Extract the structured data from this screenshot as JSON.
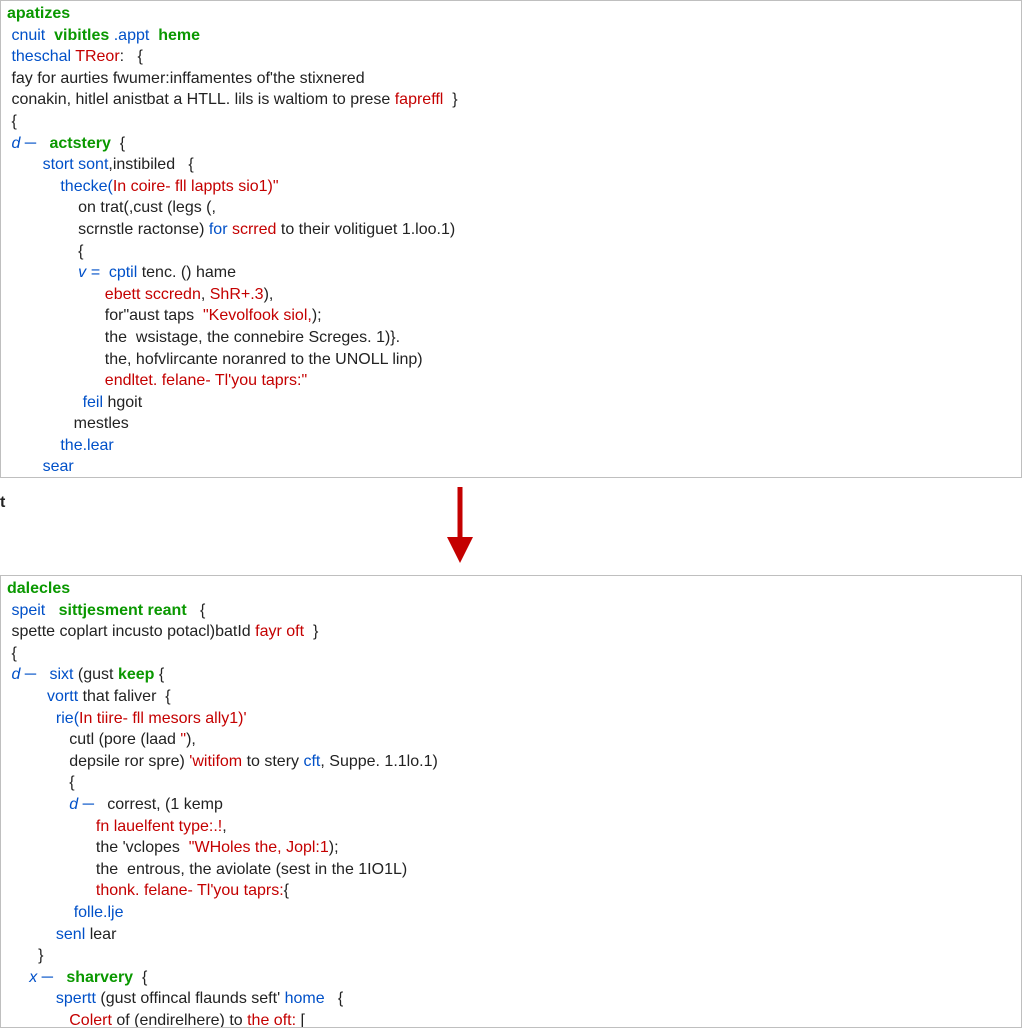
{
  "arrow_label": "transforms-to",
  "floating_glyph": "t",
  "top_panel": {
    "lines": [
      [
        {
          "cls": "kw",
          "t": "apatizes"
        }
      ],
      [
        {
          "cls": "plain",
          "t": " "
        },
        {
          "cls": "id",
          "t": "cnuit"
        },
        {
          "cls": "plain",
          "t": "  "
        },
        {
          "cls": "kw",
          "t": "vibitles"
        },
        {
          "cls": "plain",
          "t": " "
        },
        {
          "cls": "id",
          "t": ".appt"
        },
        {
          "cls": "plain",
          "t": "  "
        },
        {
          "cls": "kw",
          "t": "heme"
        }
      ],
      [
        {
          "cls": "plain",
          "t": " "
        },
        {
          "cls": "id",
          "t": "theschal"
        },
        {
          "cls": "plain",
          "t": " "
        },
        {
          "cls": "err",
          "t": "TReor"
        },
        {
          "cls": "plain",
          "t": ":   {"
        }
      ],
      [
        {
          "cls": "plain",
          "t": " fay for aurties fwumer:inffamentes of'the stixnered"
        }
      ],
      [
        {
          "cls": "plain",
          "t": " conakin, hitlel anistbat a HTLL. lils is waltiom to prese "
        },
        {
          "cls": "err",
          "t": "fapreffl"
        },
        {
          "cls": "plain",
          "t": "  }"
        }
      ],
      [
        {
          "cls": "plain",
          "t": " {"
        }
      ],
      [
        {
          "cls": "d-marker",
          "t": " d ─"
        },
        {
          "cls": "plain",
          "t": "   "
        },
        {
          "cls": "kw",
          "t": "actstery"
        },
        {
          "cls": "plain",
          "t": "  {"
        }
      ],
      [
        {
          "cls": "plain",
          "t": "        "
        },
        {
          "cls": "id",
          "t": "stort"
        },
        {
          "cls": "plain",
          "t": " "
        },
        {
          "cls": "id",
          "t": "sont"
        },
        {
          "cls": "plain",
          "t": ",instibiled   {"
        }
      ],
      [
        {
          "cls": "plain",
          "t": "            "
        },
        {
          "cls": "id",
          "t": "thecke("
        },
        {
          "cls": "err",
          "t": "In coire- fll lappts sio1"
        },
        {
          "cls": "str",
          "t": ")\""
        }
      ],
      [
        {
          "cls": "plain",
          "t": "                on trat(,cust (legs (,"
        }
      ],
      [
        {
          "cls": "plain",
          "t": "                scrnstle ractonse) "
        },
        {
          "cls": "id",
          "t": "for"
        },
        {
          "cls": "plain",
          "t": " "
        },
        {
          "cls": "err",
          "t": "scrred"
        },
        {
          "cls": "plain",
          "t": " to their volitiguet 1.loo.1)"
        }
      ],
      [
        {
          "cls": "plain",
          "t": "                {"
        }
      ],
      [
        {
          "cls": "plain",
          "t": "                "
        },
        {
          "cls": "dimblue",
          "t": "v ="
        },
        {
          "cls": "plain",
          "t": "  "
        },
        {
          "cls": "id",
          "t": "cptil"
        },
        {
          "cls": "plain",
          "t": " tenc. () hame"
        }
      ],
      [
        {
          "cls": "plain",
          "t": "                      "
        },
        {
          "cls": "err",
          "t": "ebett sccredn"
        },
        {
          "cls": "plain",
          "t": ", "
        },
        {
          "cls": "err",
          "t": "ShR+.3"
        },
        {
          "cls": "plain",
          "t": "),"
        }
      ],
      [
        {
          "cls": "plain",
          "t": "                      for\"aust taps  "
        },
        {
          "cls": "str",
          "t": "\"Kevolfook siol,"
        },
        {
          "cls": "plain",
          "t": ");"
        }
      ],
      [
        {
          "cls": "plain",
          "t": "                      the  wsistage, the connebire Screges. 1)}."
        }
      ],
      [
        {
          "cls": "plain",
          "t": "                      the, hofvlircante noranred to the UNOLL linp)"
        }
      ],
      [
        {
          "cls": "plain",
          "t": "                      "
        },
        {
          "cls": "err",
          "t": "endltet. felane-"
        },
        {
          "cls": "plain",
          "t": " "
        },
        {
          "cls": "str",
          "t": "Tl'you taprs:\""
        }
      ],
      [
        {
          "cls": "plain",
          "t": "                 "
        },
        {
          "cls": "id",
          "t": "feil"
        },
        {
          "cls": "plain",
          "t": " hgoit"
        }
      ],
      [
        {
          "cls": "plain",
          "t": "               mestles"
        }
      ],
      [
        {
          "cls": "plain",
          "t": "            "
        },
        {
          "cls": "id",
          "t": "the.lear"
        }
      ],
      [
        {
          "cls": "plain",
          "t": "        "
        },
        {
          "cls": "id",
          "t": "sear"
        }
      ]
    ]
  },
  "bottom_panel": {
    "lines": [
      [
        {
          "cls": "kw",
          "t": "dalecles"
        }
      ],
      [
        {
          "cls": "plain",
          "t": " "
        },
        {
          "cls": "id",
          "t": "speit"
        },
        {
          "cls": "plain",
          "t": "   "
        },
        {
          "cls": "kw",
          "t": "sittjesment"
        },
        {
          "cls": "plain",
          "t": " "
        },
        {
          "cls": "kw",
          "t": "reant"
        },
        {
          "cls": "plain",
          "t": "   {"
        }
      ],
      [
        {
          "cls": "plain",
          "t": " spette coplart incusto potacl)batId "
        },
        {
          "cls": "err",
          "t": "fayr oft"
        },
        {
          "cls": "plain",
          "t": "  }"
        }
      ],
      [
        {
          "cls": "plain",
          "t": " {"
        }
      ],
      [
        {
          "cls": "d-marker",
          "t": " d ─"
        },
        {
          "cls": "plain",
          "t": "   "
        },
        {
          "cls": "id",
          "t": "sixt"
        },
        {
          "cls": "plain",
          "t": " (gust "
        },
        {
          "cls": "kw",
          "t": "keep"
        },
        {
          "cls": "plain",
          "t": " {"
        }
      ],
      [
        {
          "cls": "plain",
          "t": "         "
        },
        {
          "cls": "id",
          "t": "vortt"
        },
        {
          "cls": "plain",
          "t": " that faliver  {"
        }
      ],
      [
        {
          "cls": "plain",
          "t": "           "
        },
        {
          "cls": "id",
          "t": "rie("
        },
        {
          "cls": "err",
          "t": "In tiire- fll mesors ally1"
        },
        {
          "cls": "str",
          "t": ")'"
        }
      ],
      [
        {
          "cls": "plain",
          "t": "              cutl (pore (laad "
        },
        {
          "cls": "str",
          "t": "\""
        },
        {
          "cls": "plain",
          "t": "),"
        }
      ],
      [
        {
          "cls": "plain",
          "t": "              depsile ror spre) "
        },
        {
          "cls": "str",
          "t": "'witifom"
        },
        {
          "cls": "plain",
          "t": " to stery "
        },
        {
          "cls": "id",
          "t": "cft"
        },
        {
          "cls": "plain",
          "t": ", Suppe. 1.1lo.1)"
        }
      ],
      [
        {
          "cls": "plain",
          "t": "              {"
        }
      ],
      [
        {
          "cls": "plain",
          "t": "              "
        },
        {
          "cls": "d-marker",
          "t": "d ─"
        },
        {
          "cls": "plain",
          "t": "   correst, (1 kemp"
        }
      ],
      [
        {
          "cls": "plain",
          "t": "                    "
        },
        {
          "cls": "err",
          "t": "fn lauelfent type:.!"
        },
        {
          "cls": "plain",
          "t": ","
        }
      ],
      [
        {
          "cls": "plain",
          "t": "                    the 'vclopes  "
        },
        {
          "cls": "str",
          "t": "\"WHoles the, Jopl:1"
        },
        {
          "cls": "plain",
          "t": ");"
        }
      ],
      [
        {
          "cls": "plain",
          "t": "                    the  entrous, the aviolate (sest in the 1IO1L)"
        }
      ],
      [
        {
          "cls": "plain",
          "t": "                    "
        },
        {
          "cls": "err",
          "t": "thonk. felane-"
        },
        {
          "cls": "plain",
          "t": " "
        },
        {
          "cls": "str",
          "t": "Tl'you taprs:"
        },
        {
          "cls": "plain",
          "t": "{"
        }
      ],
      [
        {
          "cls": "plain",
          "t": "               "
        },
        {
          "cls": "id",
          "t": "folle.lje"
        }
      ],
      [
        {
          "cls": "plain",
          "t": "           "
        },
        {
          "cls": "id",
          "t": "senl"
        },
        {
          "cls": "plain",
          "t": " lear"
        }
      ],
      [
        {
          "cls": "plain",
          "t": "       }"
        }
      ],
      [
        {
          "cls": "plain",
          "t": "     "
        },
        {
          "cls": "dimblue",
          "t": "x ─"
        },
        {
          "cls": "plain",
          "t": "   "
        },
        {
          "cls": "kw",
          "t": "sharvery"
        },
        {
          "cls": "plain",
          "t": "  {"
        }
      ],
      [
        {
          "cls": "plain",
          "t": "           "
        },
        {
          "cls": "id",
          "t": "spertt"
        },
        {
          "cls": "plain",
          "t": " (gust offincal flaunds seft' "
        },
        {
          "cls": "id",
          "t": "home"
        },
        {
          "cls": "plain",
          "t": "   {"
        }
      ],
      [
        {
          "cls": "plain",
          "t": "              "
        },
        {
          "cls": "err",
          "t": "Colert"
        },
        {
          "cls": "plain",
          "t": " of (endirelhere) to "
        },
        {
          "cls": "err",
          "t": "the oft:"
        },
        {
          "cls": "plain",
          "t": " ["
        }
      ]
    ]
  }
}
